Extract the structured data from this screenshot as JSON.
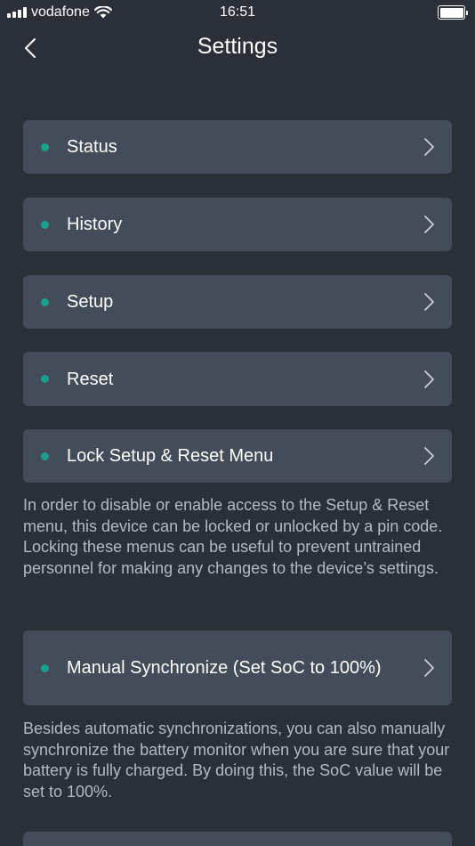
{
  "status_bar": {
    "carrier": "vodafone",
    "time": "16:51"
  },
  "header": {
    "title": "Settings"
  },
  "menu": {
    "items": [
      {
        "label": "Status"
      },
      {
        "label": "History"
      },
      {
        "label": "Setup"
      },
      {
        "label": "Reset"
      },
      {
        "label": "Lock Setup & Reset Menu"
      },
      {
        "label": "Manual Synchronize (Set SoC to 100%)"
      }
    ],
    "lock_description": "In order to disable or enable access to the Setup & Reset menu, this device can be locked or unlocked by a pin code. Locking these menus can be useful to prevent untrained personnel for making any changes to the device’s settings.",
    "sync_description": "Besides automatic synchronizations, you can also manually synchronize the battery monitor when you are sure that your battery is fully charged. By doing this, the SoC value will be set to 100%."
  },
  "colors": {
    "background": "#2b2f37",
    "card": "#454c59",
    "status_dot": "#17a08a",
    "description_text": "#b4b9c2"
  }
}
